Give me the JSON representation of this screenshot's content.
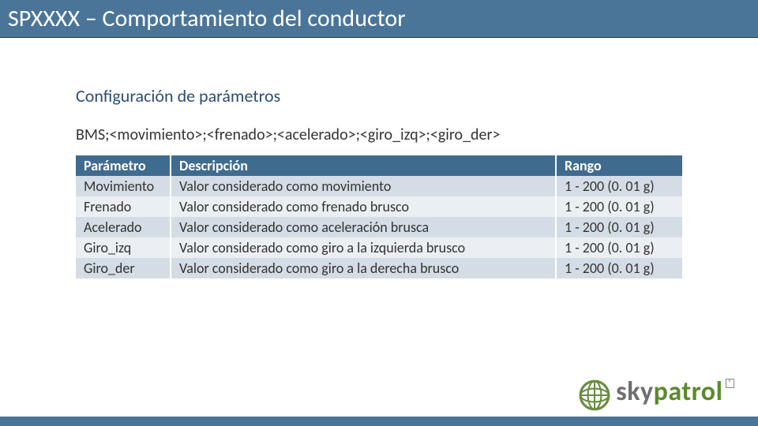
{
  "header": {
    "title": "SPXXXX – Comportamiento del conductor"
  },
  "section": {
    "heading": "Configuración de parámetros",
    "command": "BMS;<movimiento>;<frenado>;<acelerado>;<giro_izq>;<giro_der>"
  },
  "table": {
    "headers": {
      "param": "Parámetro",
      "desc": "Descripción",
      "range": "Rango"
    },
    "rows": [
      {
        "param": "Movimiento",
        "desc": "Valor considerado como movimiento",
        "range": "1 - 200 (0. 01 g)"
      },
      {
        "param": "Frenado",
        "desc": "Valor considerado como frenado brusco",
        "range": "1 - 200 (0. 01 g)"
      },
      {
        "param": "Acelerado",
        "desc": "Valor considerado como aceleración brusca",
        "range": "1 - 200 (0. 01 g)"
      },
      {
        "param": "Giro_izq",
        "desc": "Valor considerado como giro a la izquierda brusco",
        "range": "1 - 200 (0. 01 g)"
      },
      {
        "param": "Giro_der",
        "desc": "Valor considerado como giro a la derecha brusco",
        "range": "1 - 200 (0. 01 g)"
      }
    ]
  },
  "logo": {
    "text_pre": "sky",
    "text_accent": "patrol",
    "reg": "®"
  },
  "colors": {
    "header_bg": "#4a7599",
    "heading_text": "#2b4f70",
    "row_odd": "#d4dde5",
    "row_even": "#ebeff3",
    "logo_accent": "#5a8a2e"
  }
}
